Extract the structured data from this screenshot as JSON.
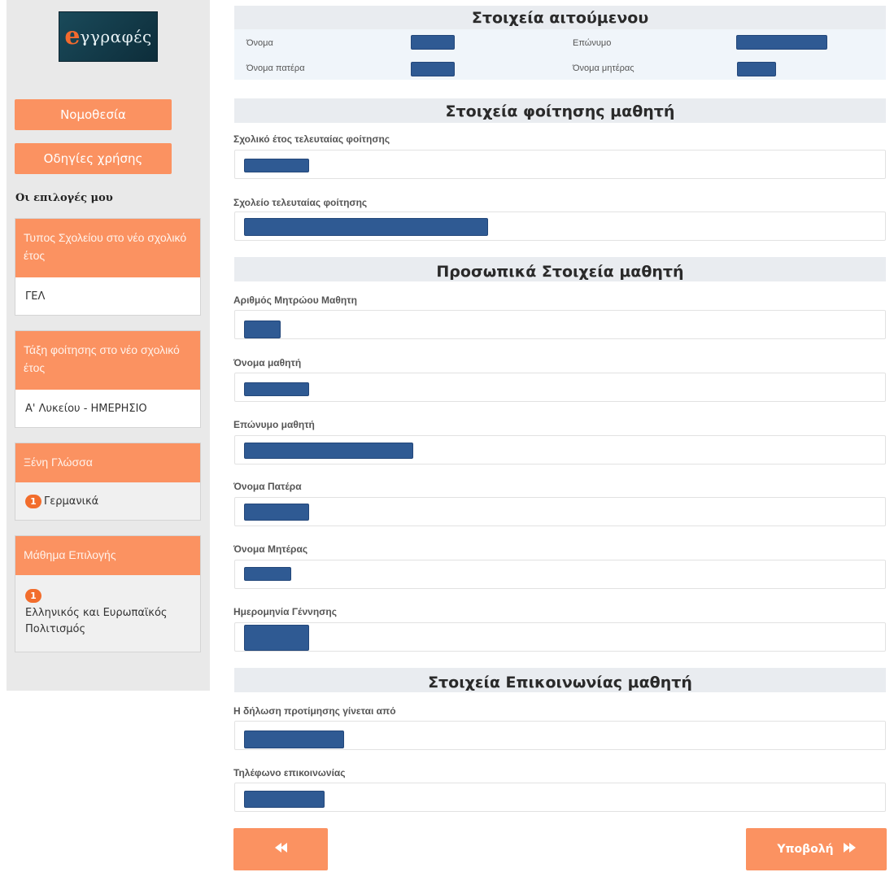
{
  "logo": {
    "letter": "e",
    "text": "γγραφές"
  },
  "sidebar": {
    "legislation_label": "Νομοθεσία",
    "instructions_label": "Οδηγίες χρήσης",
    "my_choices_title": "Οι επιλογές μου",
    "cards": [
      {
        "title": "Τυπος Σχολείου στο νέο σχολικό έτος",
        "value": "ΓΕΛ"
      },
      {
        "title": "Τάξη φοίτησης στο νέο σχολικό έτος",
        "value": "Α' Λυκείου - ΗΜΕΡΗΣΙΟ"
      },
      {
        "title": "Ξένη Γλώσσα",
        "badge": "1",
        "value": "Γερμανικά"
      },
      {
        "title": "Μάθημα Επιλογής",
        "badge": "1",
        "value": "Ελληνικός και Ευρωπαϊκός Πολιτισμός"
      }
    ]
  },
  "applicant": {
    "title": "Στοιχεία αιτούμενου",
    "first_name_label": "Όνομα",
    "last_name_label": "Επώνυμο",
    "father_name_label": "Όνομα πατέρα",
    "mother_name_label": "Όνομα μητέρας"
  },
  "attendance": {
    "title": "Στοιχεία φοίτησης μαθητή",
    "last_year_label": "Σχολικό έτος τελευταίας φοίτησης",
    "last_school_label": "Σχολείο τελευταίας φοίτησης"
  },
  "personal": {
    "title": "Προσωπικά Στοιχεία μαθητή",
    "registry_label": "Αριθμός Μητρώου Μαθητη",
    "first_name_label": "Όνομα μαθητή",
    "last_name_label": "Επώνυμο μαθητή",
    "father_label": "Όνομα Πατέρα",
    "mother_label": "Όνομα Μητέρας",
    "birthdate_label": "Ημερομηνία Γέννησης"
  },
  "contact": {
    "title": "Στοιχεία Επικοινωνίας μαθητή",
    "declaration_by_label": "Η δήλωση προτίμησης γίνεται από",
    "phone_label": "Τηλέφωνο επικοινωνίας"
  },
  "buttons": {
    "submit_label": "Υποβολή"
  },
  "colors": {
    "accent": "#fb9261",
    "redaction": "#2f5a93",
    "section_bg": "#e9ecf0",
    "sidebar_bg": "#e9e9e9"
  }
}
